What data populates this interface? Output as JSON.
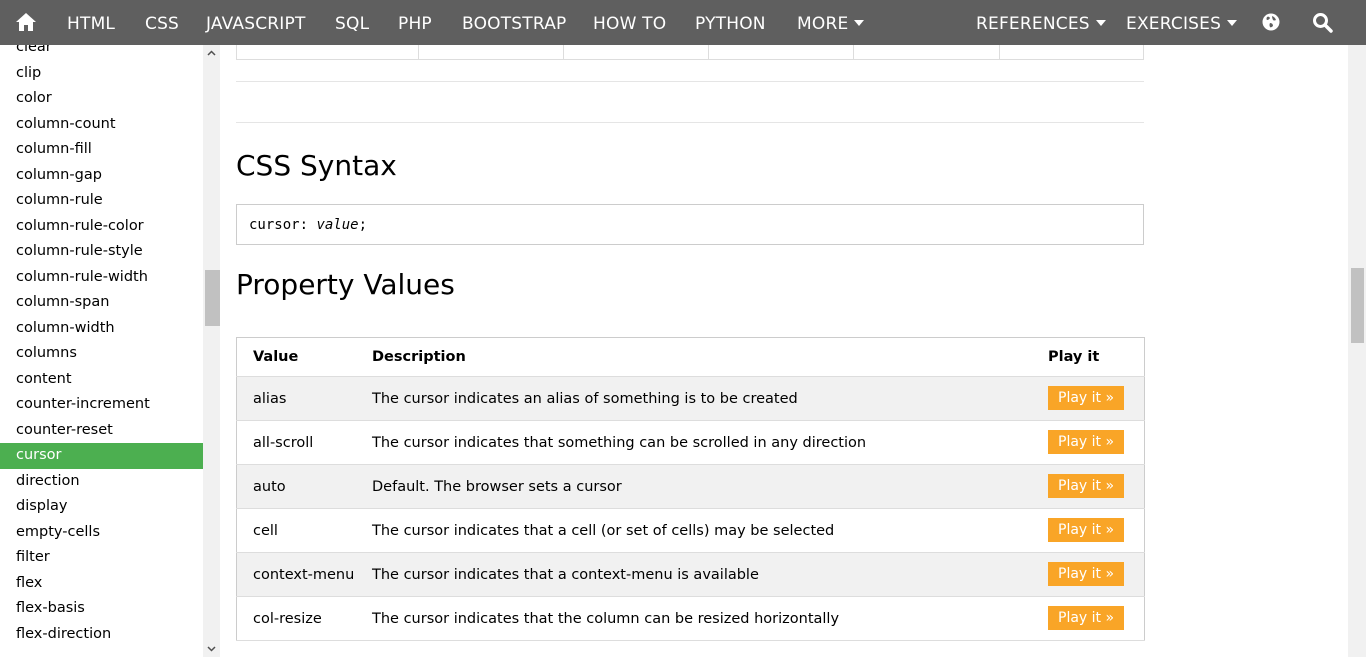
{
  "topnav": {
    "items": [
      "HTML",
      "CSS",
      "JAVASCRIPT",
      "SQL",
      "PHP",
      "BOOTSTRAP",
      "HOW TO",
      "PYTHON"
    ],
    "more": "MORE",
    "references": "REFERENCES",
    "exercises": "EXERCISES",
    "icons": [
      "home-icon",
      "globe-icon",
      "search-icon"
    ]
  },
  "sidebar": {
    "items": [
      "clear",
      "clip",
      "color",
      "column-count",
      "column-fill",
      "column-gap",
      "column-rule",
      "column-rule-color",
      "column-rule-style",
      "column-rule-width",
      "column-span",
      "column-width",
      "columns",
      "content",
      "counter-increment",
      "counter-reset",
      "cursor",
      "direction",
      "display",
      "empty-cells",
      "filter",
      "flex",
      "flex-basis",
      "flex-direction"
    ],
    "active": "cursor",
    "active_color": "#4caf50"
  },
  "main": {
    "syntax_heading": "CSS Syntax",
    "syntax_code": "cursor: ",
    "syntax_value": "value",
    "syntax_end": ";",
    "values_heading": "Property Values",
    "table": {
      "headers": [
        "Value",
        "Description",
        "Play it"
      ],
      "button_label": "Play it »",
      "button_color": "#f9a527",
      "rows": [
        {
          "value": "alias",
          "description": "The cursor indicates an alias of something is to be created"
        },
        {
          "value": "all-scroll",
          "description": "The cursor indicates that something can be scrolled in any direction"
        },
        {
          "value": "auto",
          "description": "Default. The browser sets a cursor"
        },
        {
          "value": "cell",
          "description": "The cursor indicates that a cell (or set of cells) may be selected"
        },
        {
          "value": "context-menu",
          "description": "The cursor indicates that a context-menu is available"
        },
        {
          "value": "col-resize",
          "description": "The cursor indicates that the column can be resized horizontally"
        }
      ]
    }
  }
}
